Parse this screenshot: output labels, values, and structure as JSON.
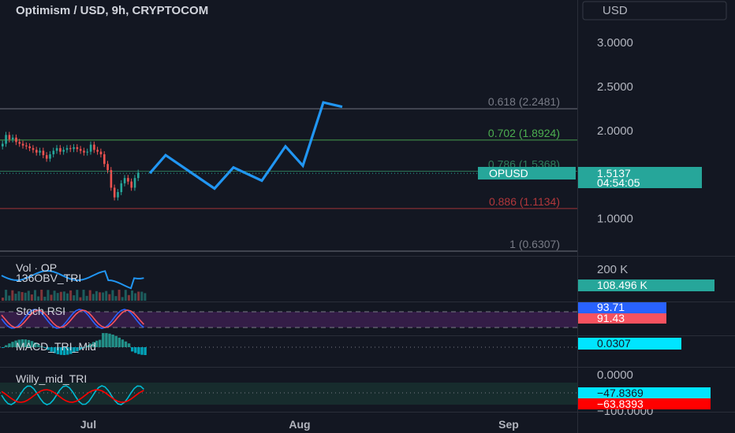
{
  "header": {
    "title": "Optimism / USD, 9h, CRYPTOCOM",
    "currency": "USD"
  },
  "colors": {
    "background": "#131722",
    "up": "#26a69a",
    "down": "#ef5350",
    "projection": "#2196f3",
    "fib_gray": "#787b86",
    "fib_green": "#4caf50",
    "fib_red": "#b2373b",
    "fib_786": "#2e7d5b",
    "stoch_band": "#3b1f4e",
    "price_tag": "#26a69a",
    "macd_tag": "#00e5ff",
    "stoch_k": "#2962ff",
    "stoch_d": "#f7525f"
  },
  "chart_data": [
    {
      "type": "line",
      "pane": "price",
      "y_ticks": [
        "3.0000",
        "2.5000",
        "2.0000",
        "1.0000"
      ],
      "y_tick_values": [
        3.0,
        2.5,
        2.0,
        1.0
      ],
      "ylim": [
        0.63,
        3.2
      ],
      "x_ticks": [
        "Jul",
        "Aug",
        "Sep"
      ],
      "symbol_label": "OPUSD",
      "last_price": "1.5137",
      "countdown": "04:54:05",
      "fib_levels": [
        {
          "label": "0.618 (2.2481)",
          "value": 2.2481,
          "tone": "gray"
        },
        {
          "label": "0.702 (1.8924)",
          "value": 1.8924,
          "tone": "green"
        },
        {
          "label": "0.786 (1.5368)",
          "value": 1.5368,
          "tone": "teal"
        },
        {
          "label": "0.886 (1.1134)",
          "value": 1.1134,
          "tone": "red"
        },
        {
          "label": "1 (0.6307)",
          "value": 0.6307,
          "tone": "gray"
        }
      ],
      "candles_close": [
        1.85,
        1.95,
        1.9,
        1.92,
        1.87,
        1.85,
        1.83,
        1.82,
        1.8,
        1.78,
        1.75,
        1.77,
        1.72,
        1.68,
        1.73,
        1.77,
        1.8,
        1.76,
        1.78,
        1.8,
        1.79,
        1.81,
        1.79,
        1.77,
        1.75,
        1.76,
        1.84,
        1.78,
        1.76,
        1.73,
        1.62,
        1.55,
        1.35,
        1.24,
        1.3,
        1.4,
        1.46,
        1.42,
        1.35,
        1.46,
        1.52
      ],
      "projection": [
        {
          "x": 190,
          "y": 1.5137
        },
        {
          "x": 210,
          "y": 1.72
        },
        {
          "x": 272,
          "y": 1.34
        },
        {
          "x": 296,
          "y": 1.58
        },
        {
          "x": 332,
          "y": 1.43
        },
        {
          "x": 362,
          "y": 1.82
        },
        {
          "x": 384,
          "y": 1.6
        },
        {
          "x": 410,
          "y": 2.32
        },
        {
          "x": 434,
          "y": 2.27
        }
      ]
    },
    {
      "type": "line",
      "pane": "volume-obv",
      "legend": [
        "Vol · OP",
        "136OBV_TRI"
      ],
      "axis_label": "200 K",
      "obv_value": "108.496 K"
    },
    {
      "type": "line",
      "pane": "stoch-rsi",
      "legend": [
        "Stoch RSI"
      ],
      "k_value": "93.71",
      "d_value": "91.43"
    },
    {
      "type": "area",
      "pane": "macd",
      "legend": [
        "MACD_TRI_Mid"
      ],
      "value": "0.0307"
    },
    {
      "type": "line",
      "pane": "willy",
      "legend": [
        "Willy_mid_TRI"
      ],
      "axis_top": "0.0000",
      "axis_bottom": "−100.0000",
      "value_fast": "−47.8369",
      "value_slow": "−63.8393"
    }
  ]
}
